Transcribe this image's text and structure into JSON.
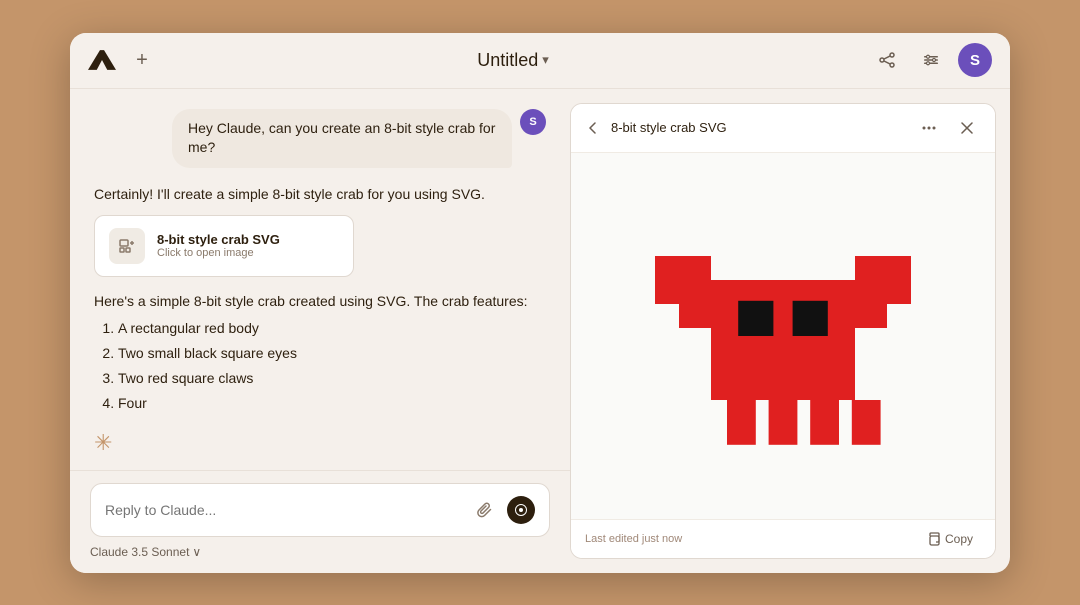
{
  "header": {
    "title": "Untitled",
    "title_dropdown": "▾",
    "new_chat_label": "+",
    "avatar_letter": "S"
  },
  "chat": {
    "user_message": "Hey Claude, can you create an 8-bit style crab for me?",
    "user_avatar": "S",
    "assistant_intro": "Certainly! I'll create a simple 8-bit style crab for you using SVG.",
    "artifact_title": "8-bit style crab SVG",
    "artifact_subtitle": "Click to open image",
    "response_prefix": "Here's a simple 8-bit style crab created using SVG. The crab features:",
    "features": [
      "A rectangular red body",
      "Two small black square eyes",
      "Two red square claws",
      "Four"
    ],
    "input_placeholder": "Reply to Claude...",
    "model_label": "Claude 3.5 Sonnet",
    "model_dropdown": "∨"
  },
  "artifact_panel": {
    "title": "8-bit style crab SVG",
    "timestamp": "Last edited just now",
    "copy_label": "Copy"
  },
  "icons": {
    "share": "↑",
    "settings": "⚙",
    "back_arrow": "←",
    "more": "•••",
    "close": "✕",
    "attach": "📎",
    "voice_circle": "⊙",
    "copy_icon": "⧉"
  }
}
